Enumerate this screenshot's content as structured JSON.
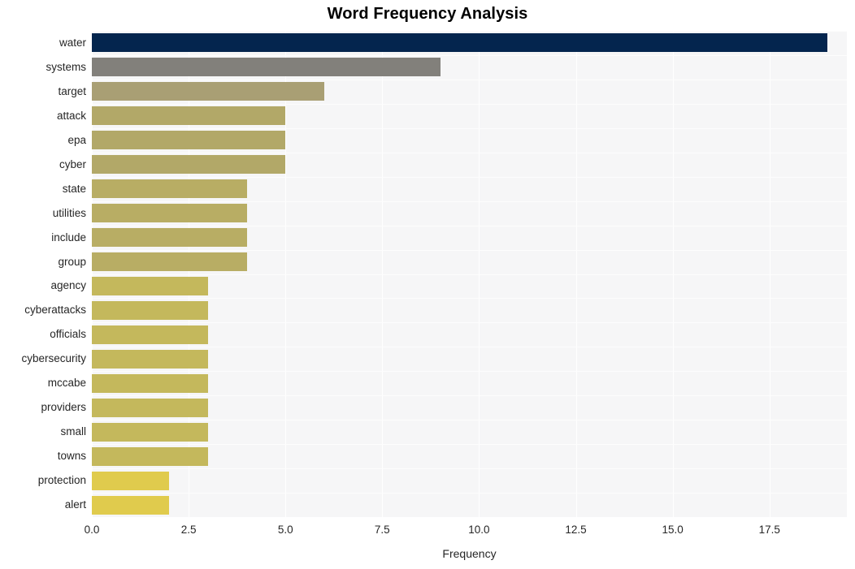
{
  "chart_data": {
    "type": "bar",
    "orientation": "horizontal",
    "title": "Word Frequency Analysis",
    "xlabel": "Frequency",
    "ylabel": "",
    "grid": true,
    "legend": false,
    "xlim": [
      0,
      19.5
    ],
    "xticks": [
      "0.0",
      "2.5",
      "5.0",
      "7.5",
      "10.0",
      "12.5",
      "15.0",
      "17.5"
    ],
    "xtick_values": [
      0,
      2.5,
      5,
      7.5,
      10,
      12.5,
      15,
      17.5
    ],
    "categories": [
      "water",
      "systems",
      "target",
      "attack",
      "epa",
      "cyber",
      "state",
      "utilities",
      "include",
      "group",
      "agency",
      "cyberattacks",
      "officials",
      "cybersecurity",
      "mccabe",
      "providers",
      "small",
      "towns",
      "protection",
      "alert"
    ],
    "values": [
      19,
      9,
      6,
      5,
      5,
      5,
      4,
      4,
      4,
      4,
      3,
      3,
      3,
      3,
      3,
      3,
      3,
      3,
      2,
      2
    ],
    "bar_colors": [
      "#04254e",
      "#82807b",
      "#a99f74",
      "#b2a868",
      "#b2a868",
      "#b2a868",
      "#b8ad64",
      "#b8ad64",
      "#b8ad64",
      "#b8ad64",
      "#c4b85c",
      "#c4b85c",
      "#c4b85c",
      "#c4b85c",
      "#c4b85c",
      "#c4b85c",
      "#c4b85c",
      "#c4b85c",
      "#e0cb4d",
      "#e0cb4d"
    ],
    "plot_background": "#f6f6f7",
    "grid_color": "#ffffff",
    "figure_background": "#ffffff"
  }
}
